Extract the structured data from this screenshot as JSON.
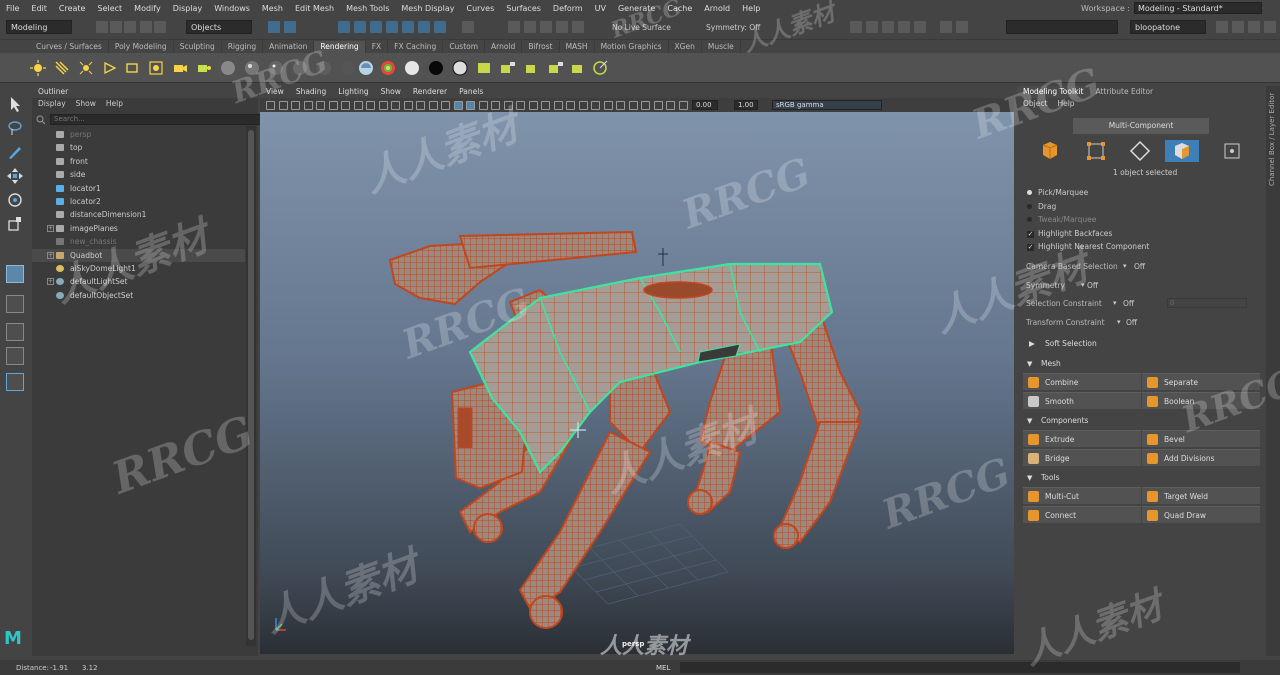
{
  "menubar": {
    "items": [
      "File",
      "Edit",
      "Create",
      "Select",
      "Modify",
      "Display",
      "Windows",
      "Mesh",
      "Edit Mesh",
      "Mesh Tools",
      "Mesh Display",
      "Curves",
      "Surfaces",
      "Deform",
      "UV",
      "Generate",
      "Cache",
      "Arnold",
      "Help"
    ],
    "workspace_label": "Workspace :",
    "workspace_value": "Modeling - Standard*"
  },
  "statusline": {
    "mode_menu": "Modeling",
    "selection_mode": "Objects",
    "live_surface": "No Live Surface",
    "symmetry": "Symmetry: Off",
    "user": "bloopatone"
  },
  "shelf": {
    "tabs": [
      "Curves / Surfaces",
      "Poly Modeling",
      "Sculpting",
      "Rigging",
      "Animation",
      "Rendering",
      "FX",
      "FX Caching",
      "Custom",
      "Arnold",
      "Bifrost",
      "MASH",
      "Motion Graphics",
      "XGen",
      "Muscle"
    ],
    "active_tab": "Rendering"
  },
  "outliner": {
    "title": "Outliner",
    "menus": [
      "Display",
      "Show",
      "Help"
    ],
    "search_placeholder": "Search...",
    "items": [
      {
        "label": "persp",
        "dim": true,
        "expand": false,
        "icon": "camera-icon"
      },
      {
        "label": "top",
        "dim": false,
        "expand": false,
        "icon": "camera-icon"
      },
      {
        "label": "front",
        "dim": false,
        "expand": false,
        "icon": "camera-icon"
      },
      {
        "label": "side",
        "dim": false,
        "expand": false,
        "icon": "camera-icon"
      },
      {
        "label": "locator1",
        "dim": false,
        "expand": false,
        "icon": "locator-icon"
      },
      {
        "label": "locator2",
        "dim": false,
        "expand": false,
        "icon": "locator-icon"
      },
      {
        "label": "distanceDimension1",
        "dim": false,
        "expand": false,
        "icon": "dimension-icon"
      },
      {
        "label": "imagePlanes",
        "dim": false,
        "expand": true,
        "icon": "folder-icon"
      },
      {
        "label": "new_chassis",
        "dim": true,
        "expand": false,
        "icon": "mesh-icon"
      },
      {
        "label": "Quadbot",
        "dim": false,
        "expand": true,
        "icon": "group-icon",
        "selected": true
      },
      {
        "label": "aiSkyDomeLight1",
        "dim": false,
        "expand": false,
        "icon": "light-icon"
      },
      {
        "label": "defaultLightSet",
        "dim": false,
        "expand": true,
        "icon": "set-icon"
      },
      {
        "label": "defaultObjectSet",
        "dim": false,
        "expand": false,
        "icon": "set-icon"
      }
    ]
  },
  "viewport": {
    "menus": [
      "View",
      "Shading",
      "Lighting",
      "Show",
      "Renderer",
      "Panels"
    ],
    "exposure": "0.00",
    "gamma": "1.00",
    "color_space": "sRGB gamma",
    "camera_label": "persp"
  },
  "toolkit": {
    "tabs": [
      "Modeling Toolkit",
      "Attribute Editor"
    ],
    "menus": [
      "Object",
      "Help"
    ],
    "multi_component": "Multi-Component",
    "selection_info": "1 object selected",
    "pick_options": [
      "Pick/Marquee",
      "Drag",
      "Tweak/Marquee"
    ],
    "checkboxes": [
      "Highlight Backfaces",
      "Highlight Nearest Component"
    ],
    "settings": [
      {
        "label": "Camera Based Selection",
        "value": "Off"
      },
      {
        "label": "Symmetry",
        "value": "Off"
      },
      {
        "label": "Selection Constraint",
        "value": "Off",
        "extra": "0"
      },
      {
        "label": "Transform Constraint",
        "value": "Off"
      }
    ],
    "soft_selection": "Soft Selection",
    "sections": [
      {
        "title": "Mesh",
        "buttons": [
          "Combine",
          "Separate",
          "Smooth",
          "Boolean"
        ]
      },
      {
        "title": "Components",
        "buttons": [
          "Extrude",
          "Bevel",
          "Bridge",
          "Add Divisions"
        ]
      },
      {
        "title": "Tools",
        "buttons": [
          "Multi-Cut",
          "Target Weld",
          "Connect",
          "Quad Draw"
        ]
      }
    ]
  },
  "side_strip": "Channel Box / Layer Editor",
  "bottombar": {
    "distance_label": "Distance:",
    "distance_a": "-1.91",
    "distance_b": "3.12",
    "mel_label": "MEL"
  },
  "watermarks": {
    "rrcg": "RRCG",
    "cn": "人人素材"
  },
  "colors": {
    "wire_orange": "#c2461d",
    "wire_green": "#3fe3a0",
    "accent_blue": "#3f6c8f"
  }
}
